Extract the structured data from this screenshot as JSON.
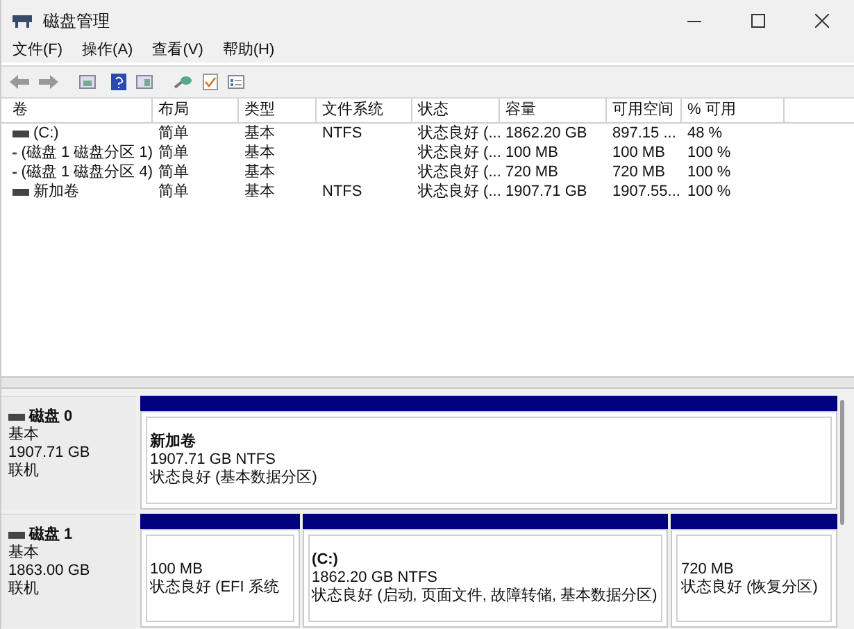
{
  "window": {
    "title": "磁盘管理"
  },
  "menu": [
    "文件(F)",
    "操作(A)",
    "查看(V)",
    "帮助(H)"
  ],
  "table": {
    "columns": [
      "卷",
      "布局",
      "类型",
      "文件系统",
      "状态",
      "容量",
      "可用空间",
      "% 可用"
    ],
    "rows": [
      [
        "(C:)",
        "简单",
        "基本",
        "NTFS",
        "状态良好 (...",
        "1862.20 GB",
        "897.15 ...",
        "48 %"
      ],
      [
        "(磁盘 1 磁盘分区 1)",
        "简单",
        "基本",
        "",
        "状态良好 (...",
        "100 MB",
        "100 MB",
        "100 %"
      ],
      [
        "(磁盘 1 磁盘分区 4)",
        "简单",
        "基本",
        "",
        "状态良好 (...",
        "720 MB",
        "720 MB",
        "100 %"
      ],
      [
        "新加卷",
        "简单",
        "基本",
        "NTFS",
        "状态良好 (...",
        "1907.71 GB",
        "1907.55...",
        "100 %"
      ]
    ]
  },
  "disks": [
    {
      "name": "磁盘 0",
      "type": "基本",
      "size": "1907.71 GB",
      "state": "联机",
      "partitions": [
        {
          "label": "新加卷",
          "size": "1907.71 GB NTFS",
          "status": "状态良好 (基本数据分区)"
        }
      ]
    },
    {
      "name": "磁盘 1",
      "type": "基本",
      "size": "1863.00 GB",
      "state": "联机",
      "partitions": [
        {
          "size": "100 MB",
          "status": "状态良好 (EFI 系统"
        },
        {
          "label": "(C:)",
          "size": "1862.20 GB NTFS",
          "status": "状态良好 (启动, 页面文件, 故障转储, 基本数据分区)"
        },
        {
          "size": "720 MB",
          "status": "状态良好 (恢复分区)"
        }
      ]
    }
  ]
}
